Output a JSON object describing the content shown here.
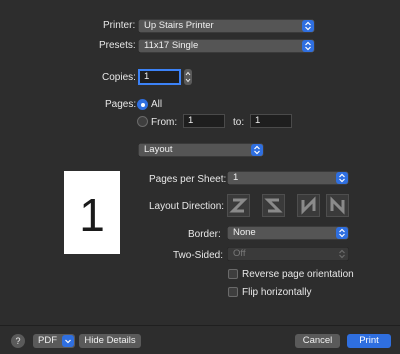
{
  "printer": {
    "label": "Printer:",
    "value": "Up Stairs Printer"
  },
  "presets": {
    "label": "Presets:",
    "value": "11x17 Single"
  },
  "copies": {
    "label": "Copies:",
    "value": "1"
  },
  "pages": {
    "label": "Pages:",
    "all_label": "All",
    "from_label": "From:",
    "from_value": "1",
    "to_label": "to:",
    "to_value": "1",
    "selected": "All"
  },
  "section": {
    "value": "Layout"
  },
  "preview": {
    "page_number": "1"
  },
  "layout": {
    "pages_per_sheet": {
      "label": "Pages per Sheet:",
      "value": "1"
    },
    "direction": {
      "label": "Layout Direction:",
      "options": [
        "Z",
        "S",
        "N",
        "N"
      ]
    },
    "border": {
      "label": "Border:",
      "value": "None"
    },
    "two_sided": {
      "label": "Two-Sided:",
      "value": "Off"
    },
    "reverse": {
      "label": "Reverse page orientation",
      "checked": false
    },
    "flip": {
      "label": "Flip horizontally",
      "checked": false
    }
  },
  "footer": {
    "help": "?",
    "pdf": "PDF",
    "hide_details": "Hide Details",
    "cancel": "Cancel",
    "print": "Print"
  },
  "colors": {
    "accent": "#2f6fe0",
    "background": "#2d2d2d"
  }
}
